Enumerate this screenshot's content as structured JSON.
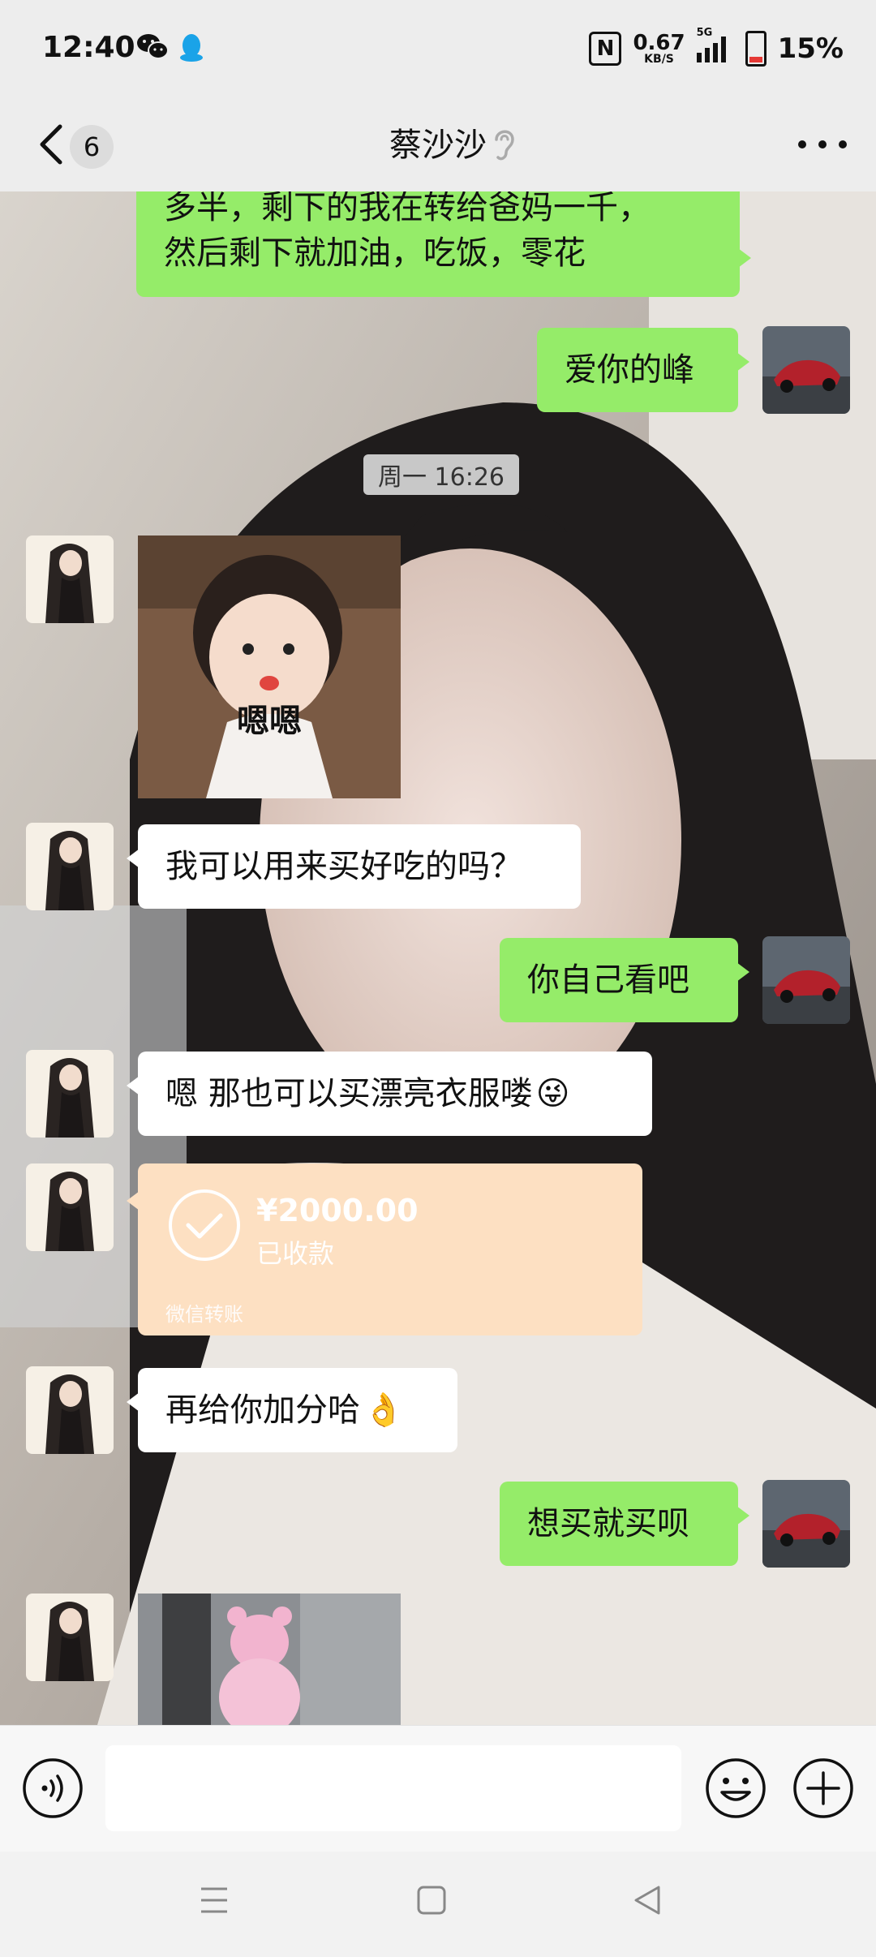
{
  "status_bar": {
    "time": "12:40",
    "app_icons": [
      "wechat-icon",
      "qq-icon"
    ],
    "nfc": "N",
    "net_speed_value": "0.67",
    "net_speed_unit": "KB/S",
    "network": "5G",
    "battery_percent": "15%"
  },
  "header": {
    "unread_count": "6",
    "contact_name": "蔡沙沙",
    "mode_icon": "ear-icon"
  },
  "messages": [
    {
      "from": "me",
      "lines": [
        "多半，剩下的我在转给爸妈一千，",
        "然后剩下就加油，吃饭，零花"
      ]
    },
    {
      "from": "me",
      "text": "爱你的峰"
    },
    {
      "type": "timestamp",
      "text": "周一 16:26"
    },
    {
      "from": "them",
      "type": "sticker",
      "caption": "嗯嗯"
    },
    {
      "from": "them",
      "text": "我可以用来买好吃的吗？"
    },
    {
      "from": "me",
      "text": "你自己看吧"
    },
    {
      "from": "them",
      "text": "嗯 那也可以买漂亮衣服喽",
      "emoji": "😜"
    },
    {
      "from": "them",
      "type": "transfer",
      "amount": "¥2000.00",
      "status": "已收款",
      "footer": "微信转账"
    },
    {
      "from": "them",
      "text": "再给你加分哈",
      "emoji": "👌"
    },
    {
      "from": "me",
      "text": "想买就买呗"
    },
    {
      "from": "them",
      "type": "sticker",
      "caption": ""
    }
  ],
  "input": {
    "placeholder": "",
    "value": ""
  },
  "colors": {
    "my_bubble": "#95ec69",
    "their_bubble": "#ffffff",
    "transfer_card": "#fde0c2",
    "background": "#ededed"
  }
}
